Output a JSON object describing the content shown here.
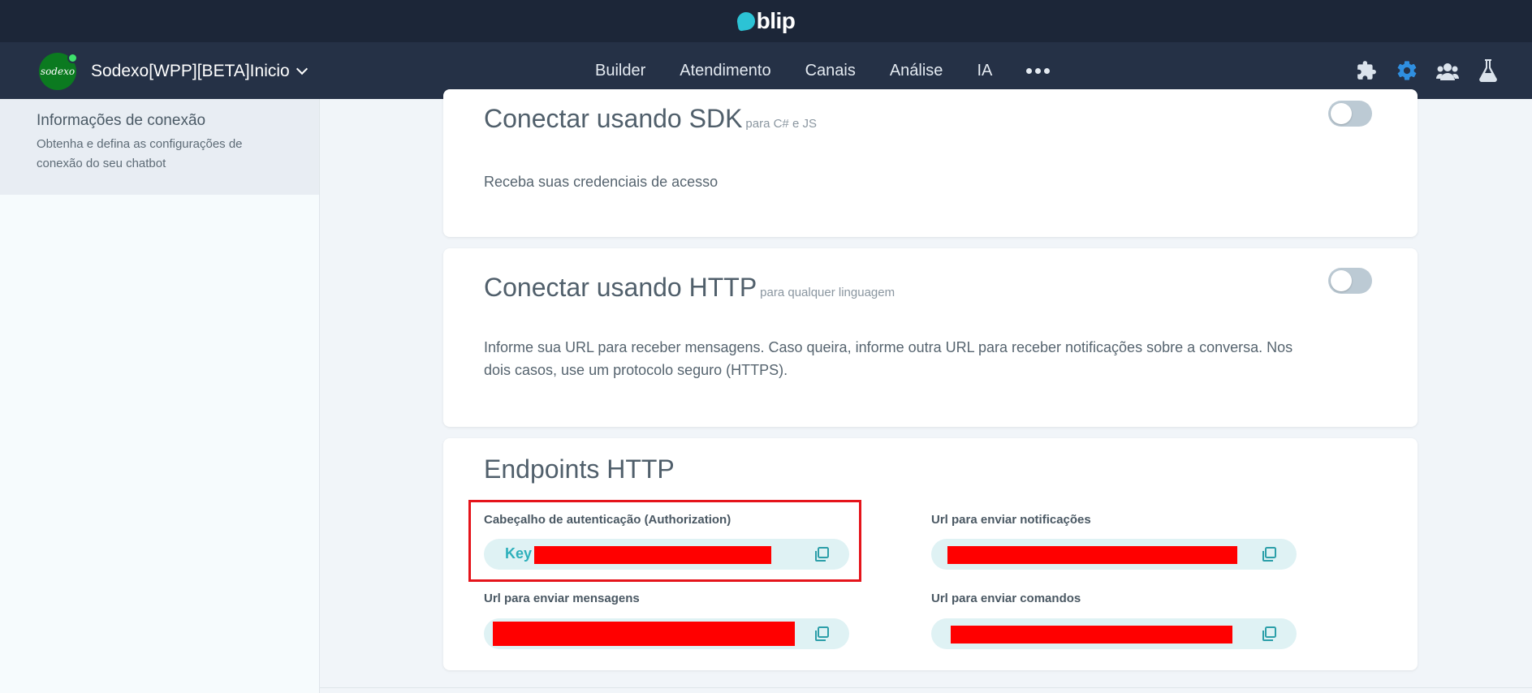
{
  "brand": {
    "logo_text": "blip"
  },
  "nav": {
    "bot_name": "Sodexo[WPP][BETA]Inicio",
    "avatar_text": "sodexo",
    "items": [
      "Builder",
      "Atendimento",
      "Canais",
      "Análise",
      "IA"
    ],
    "right_icons": [
      "puzzle-icon",
      "gear-icon",
      "team-icon",
      "flask-icon"
    ]
  },
  "sidebar": {
    "active_title": "Informações de conexão",
    "active_desc": "Obtenha e defina as configurações de conexão do seu chatbot"
  },
  "sdk_card": {
    "title": "Conectar usando SDK",
    "subtitle": "para C# e JS",
    "text": "Receba suas credenciais de acesso",
    "enabled": false
  },
  "http_card": {
    "title": "Conectar usando HTTP",
    "subtitle": "para qualquer linguagem",
    "text": "Informe sua URL para receber mensagens. Caso queira, informe outra URL para receber notificações sobre a conversa. Nos dois casos, use um protocolo seguro (HTTPS).",
    "enabled": false
  },
  "endpoints": {
    "title": "Endpoints HTTP",
    "auth_label": "Cabeçalho de autenticação (Authorization)",
    "auth_prefix": "Key",
    "notifications_label": "Url para enviar notificações",
    "messages_label": "Url para enviar mensagens",
    "commands_label": "Url para enviar comandos"
  },
  "colors": {
    "brand_dark": "#1c2638",
    "nav_bg": "#253146",
    "accent": "#2cc3d5",
    "redaction": "#ff0000",
    "highlight_border": "#e5141b"
  }
}
